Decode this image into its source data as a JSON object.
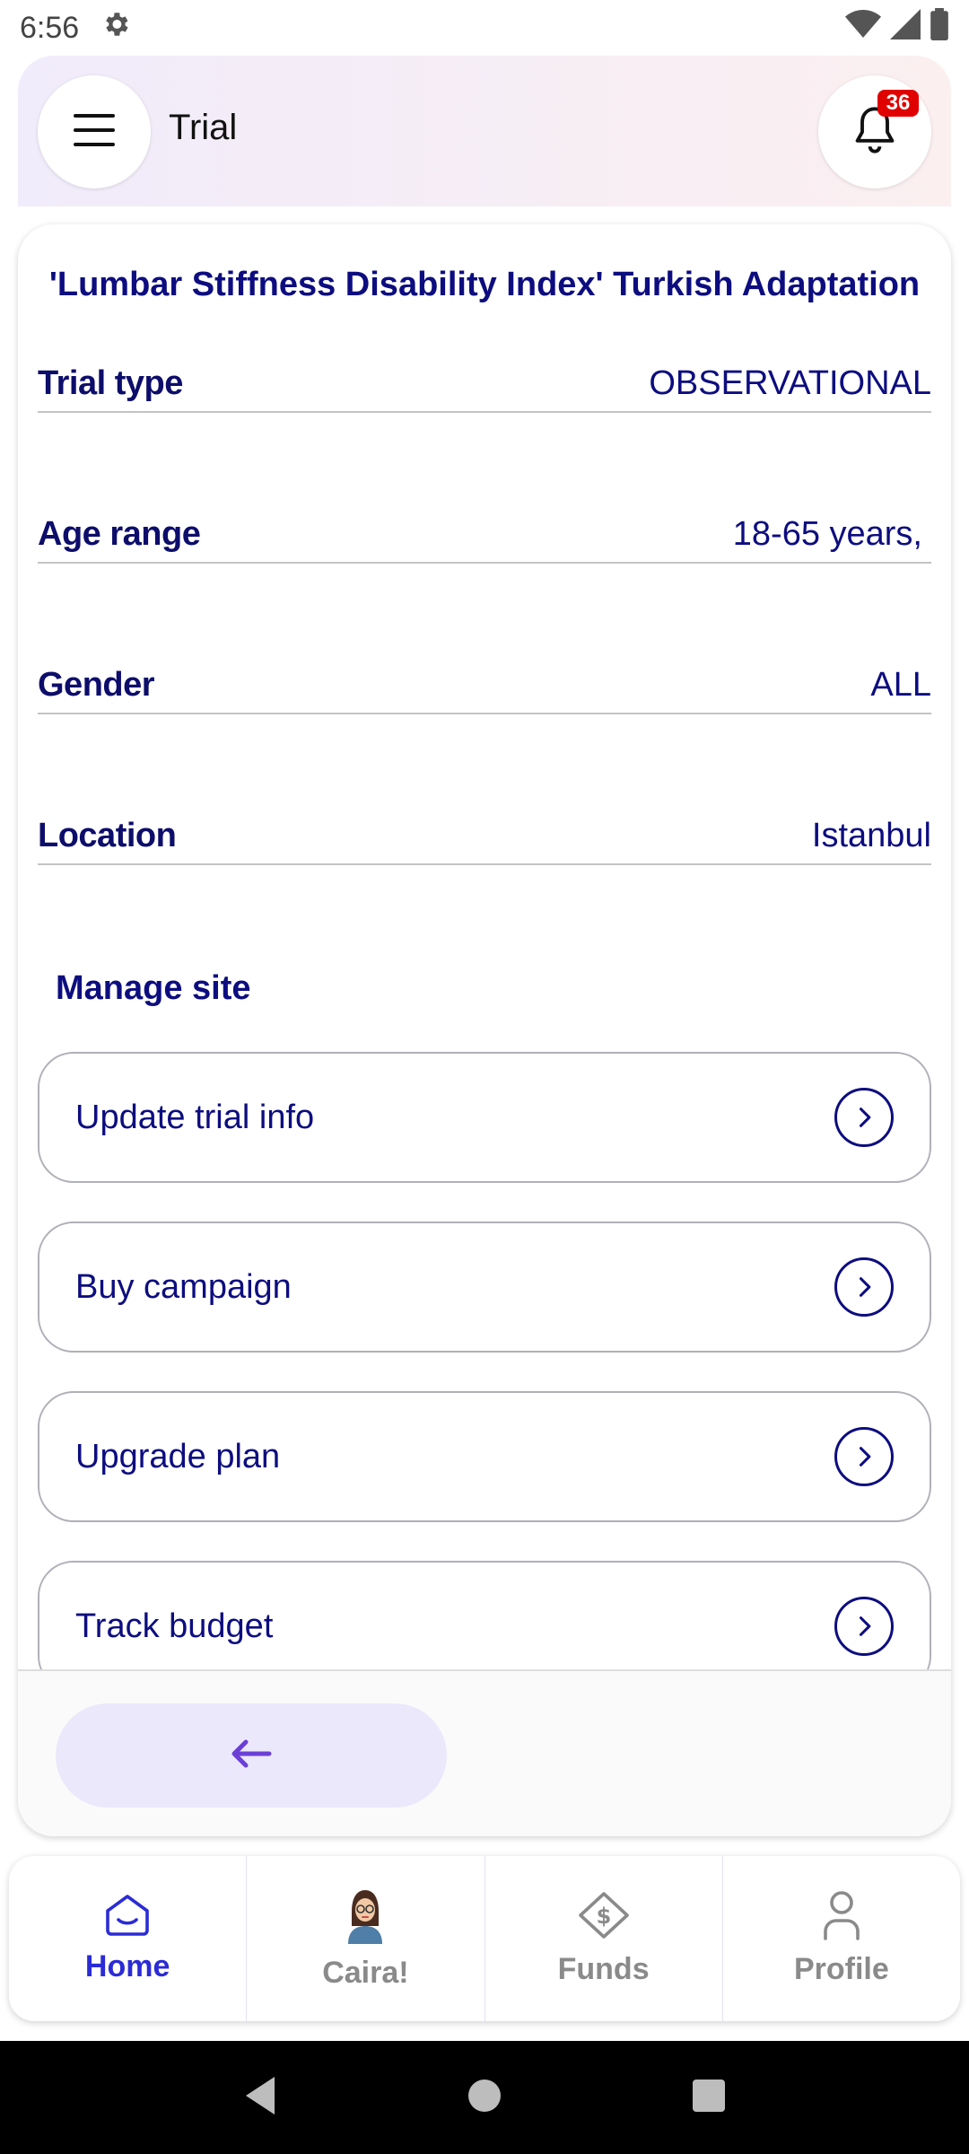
{
  "status_bar": {
    "time": "6:56"
  },
  "header": {
    "title": "Trial",
    "notification_count": "36"
  },
  "trial": {
    "title": "'Lumbar Stiffness Disability Index' Turkish Adaptation",
    "fields": [
      {
        "label": "Trial type",
        "value": "OBSERVATIONAL"
      },
      {
        "label": "Age range",
        "value": "18-65 years,"
      },
      {
        "label": "Gender",
        "value": "ALL"
      },
      {
        "label": "Location",
        "value": "Istanbul"
      }
    ]
  },
  "manage_site": {
    "title": "Manage site",
    "actions": [
      {
        "label": "Update trial info"
      },
      {
        "label": "Buy campaign"
      },
      {
        "label": "Upgrade plan"
      },
      {
        "label": "Track budget"
      }
    ]
  },
  "bottom_nav": {
    "items": [
      {
        "label": "Home",
        "icon": "home-icon",
        "active": true
      },
      {
        "label": "Caira!",
        "icon": "caira-avatar-icon",
        "active": false
      },
      {
        "label": "Funds",
        "icon": "funds-icon",
        "active": false
      },
      {
        "label": "Profile",
        "icon": "profile-icon",
        "active": false
      }
    ]
  },
  "colors": {
    "primary_text": "#0d0d80",
    "active_nav": "#2b2bd6",
    "back_button_bg": "#ece8fb",
    "back_arrow": "#6b3fd6",
    "badge": "#e00000"
  }
}
